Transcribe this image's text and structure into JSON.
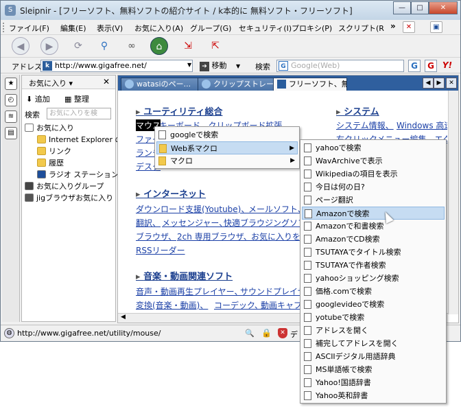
{
  "window": {
    "title": "Sleipnir - [フリーソフト、無料ソフトの紹介サイト / k本的に 無料ソフト・フリーソフト]"
  },
  "caption": {
    "minimize": "—",
    "maximize": "□",
    "close": "✕"
  },
  "menubar": {
    "items": [
      "ファイル(F)",
      "編集(E)",
      "表示(V)",
      "お気に入り(A)",
      "グループ(G)",
      "セキュリティ(I)",
      "プロキシ(P)",
      "スクリプト(R"
    ],
    "more": "»"
  },
  "addressbar": {
    "label": "アドレス",
    "url": "http://www.gigafree.net/",
    "search_value": "google",
    "go_label": "移動",
    "search_label": "検索",
    "web_search_placeholder": "Google(Web)"
  },
  "sidebar": {
    "title": "お気に入り",
    "close": "✕",
    "add_label": "追加",
    "organize_label": "整理",
    "search_label": "検索",
    "search_placeholder": "お気に入りを検",
    "items": [
      {
        "label": "お気に入り",
        "icon": "heart-icon"
      },
      {
        "label": "Internet Explorer の",
        "icon": "folder-icon"
      },
      {
        "label": "リンク",
        "icon": "folder-icon"
      },
      {
        "label": "履歴",
        "icon": "folder-icon"
      },
      {
        "label": "ラジオ ステーション ガ",
        "icon": "media-icon"
      },
      {
        "label": "お気に入りグループ",
        "icon": "group-icon"
      },
      {
        "label": "jigブラウザお気に入り",
        "icon": "jig-icon"
      }
    ]
  },
  "tabs": [
    {
      "label": "watasiのペー..."
    },
    {
      "label": "クリップストレー..."
    },
    {
      "label": "フリーソフト、無..."
    }
  ],
  "page": {
    "section1": "ユーティリティ総合",
    "section1_links": [
      "マウス",
      "キーボード、クリップボード拡張、",
      "ファイ",
      "ランチ",
      "デスク"
    ],
    "section1_right": "システム",
    "section1_right_links": [
      "システム情報、",
      "Windows 高速",
      "右クリックメニュー編集、エクス"
    ],
    "section2": "インターネット",
    "section2_links": [
      "ダウンロード支援(Youtube)、",
      "メールソフト、",
      "翻訳、",
      "メッセンジャー、",
      "快適ブラウジングソフ",
      "ブラウザ、",
      "2ch 専用ブラウザ、",
      "お気に入りを",
      "RSSリーダー"
    ],
    "section3": "音楽・動画関連ソフト",
    "section3_links": [
      "音声・動画再生プレイヤー、",
      "サウンドプレイヤ",
      "変換(音楽・動画)、",
      "コーデック、",
      "動画キャプ"
    ]
  },
  "status": {
    "url": "http://www.gigafree.net/utility/mouse/",
    "extra": "デ"
  },
  "context_menu": {
    "items": [
      {
        "label": "googleで検索",
        "submenu": false
      },
      {
        "label": "Web系マクロ",
        "submenu": true
      },
      {
        "label": "マクロ",
        "submenu": true
      }
    ]
  },
  "submenu": {
    "items": [
      "yahooで検索",
      "WavArchiveで表示",
      "Wikipediaの項目を表示",
      "今日は何の日?",
      "ページ翻訳",
      "Amazonで検索",
      "Amazonで和書検索",
      "AmazonでCD検索",
      "TSUTAYAでタイトル検索",
      "TSUTAYAで作者検索",
      "yahooショッピング検索",
      "価格.comで検索",
      "googlevideoで検索",
      "yotubeで検索",
      "アドレスを開く",
      "補完してアドレスを開く",
      "ASCIIデジタル用語辞典",
      "MS単語帳で検索",
      "Yahoo!国語辞書",
      "Yahoo英和辞書"
    ],
    "selected_index": 5
  }
}
